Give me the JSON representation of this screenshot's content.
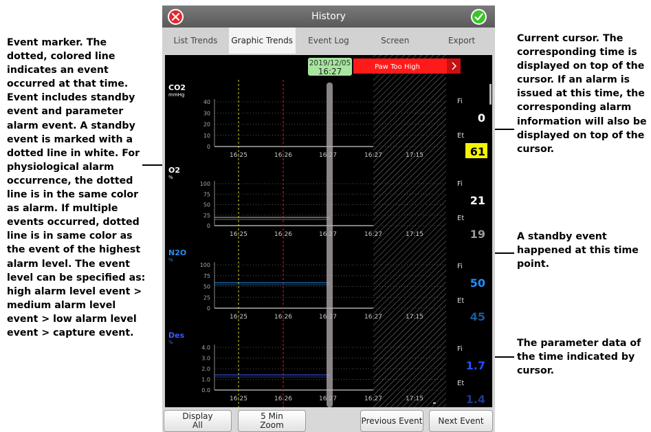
{
  "annotations": {
    "event_marker": "Event marker. The dotted, colored line indicates an event occurred at that time. Event includes standby event and parameter alarm event. A standby event is marked with a dotted line in white. For physiological alarm occurrence, the dotted line is in the same color as alarm. If multiple events occurred, dotted line is in same color as the event of the highest alarm level. The event level can be specified as: high alarm level event > medium alarm level event > low alarm level event > capture event.",
    "current_cursor": "Current cursor. The corresponding time is displayed on top of the cursor. If an alarm is issued at this time, the corresponding alarm information will also be displayed on top of the cursor.",
    "standby_event": "A standby event happened at this time point.",
    "parameter_data": "The parameter data of the time indicated by cursor."
  },
  "window": {
    "title": "History"
  },
  "tabs": [
    {
      "label": "List Trends",
      "active": false
    },
    {
      "label": "Graphic Trends",
      "active": true
    },
    {
      "label": "Event Log",
      "active": false
    },
    {
      "label": "Screen",
      "active": false
    },
    {
      "label": "Export",
      "active": false
    }
  ],
  "cursor": {
    "date": "2019/12/05",
    "time": "16:27",
    "alarm": "Paw Too High",
    "alarm_color": "#ff1a1a"
  },
  "time_ticks": [
    "16:25",
    "16:26",
    "16:27",
    "16:27",
    "17:15"
  ],
  "event_markers": [
    {
      "color": "#d6d62a",
      "time": "16:25"
    },
    {
      "color": "#ff1a1a",
      "time": "16:26"
    }
  ],
  "standby_region": "16:27 – 17:15",
  "panels": [
    {
      "name": "CO2",
      "unit": "mmHg",
      "name_color": "#ffffff",
      "yticks": [
        "40",
        "30",
        "20",
        "10",
        "0"
      ],
      "fi_label": "Fi",
      "fi_value": "0",
      "et_label": "Et",
      "et_value": "61",
      "fi_color": "#ffffff",
      "et_color": "#000000",
      "et_bg": "#f5f500"
    },
    {
      "name": "O2",
      "unit": "%",
      "name_color": "#ffffff",
      "yticks": [
        "100",
        "75",
        "50",
        "25",
        "0"
      ],
      "fi_label": "Fi",
      "fi_value": "21",
      "et_label": "Et",
      "et_value": "19",
      "fi_color": "#ffffff",
      "et_color": "#9a9a9a",
      "et_bg": ""
    },
    {
      "name": "N2O",
      "unit": "%",
      "name_color": "#2a8ff0",
      "yticks": [
        "100",
        "75",
        "50",
        "25",
        "0"
      ],
      "fi_label": "Fi",
      "fi_value": "50",
      "et_label": "Et",
      "et_value": "45",
      "fi_color": "#1e90ff",
      "et_color": "#1a5a9a",
      "et_bg": ""
    },
    {
      "name": "Des",
      "unit": "%",
      "name_color": "#3a5aff",
      "yticks": [
        "4.0",
        "3.0",
        "2.0",
        "1.0",
        "0.0"
      ],
      "fi_label": "Fi",
      "fi_value": "1.7",
      "et_label": "Et",
      "et_value": "1.4",
      "fi_color": "#2050ff",
      "et_color": "#1a3a8a",
      "et_bg": ""
    }
  ],
  "bottom_buttons": {
    "display_all": [
      "Display",
      "All"
    ],
    "zoom": [
      "5 Min",
      "Zoom"
    ],
    "previous_event": "Previous Event",
    "next_event": "Next Event"
  }
}
